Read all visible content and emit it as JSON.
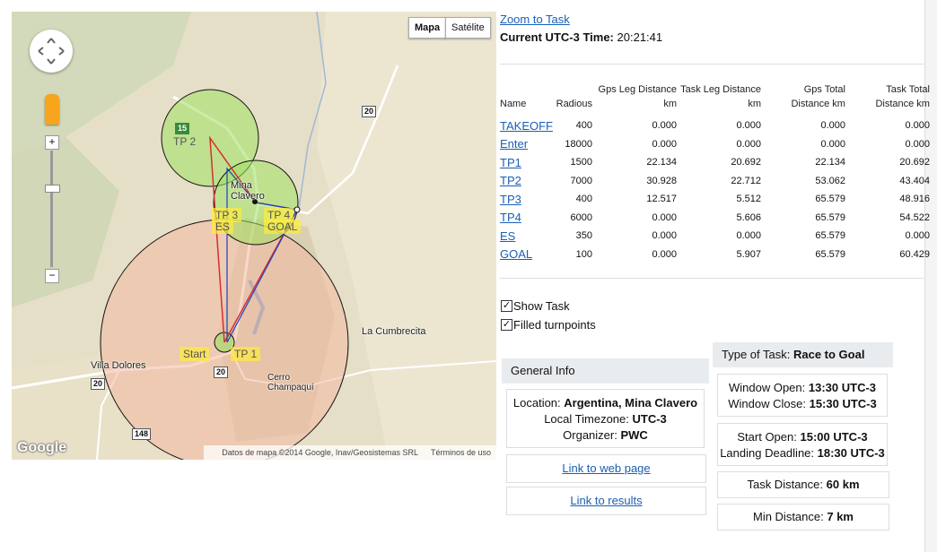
{
  "map": {
    "type_buttons": {
      "map": "Mapa",
      "satellite": "Satélite"
    },
    "attribution": "Datos de mapa ©2014 Google, Inav/Geosistemas SRL",
    "terms": "Términos de uso",
    "logo": "Google",
    "places": {
      "mina_clavero": "Mina\nClavero",
      "la_cumbrecita": "La Cumbrecita",
      "villa_dolores": "Villa Dolores",
      "cerro": "Cerro\nChampaquí"
    },
    "route_shields": [
      "15",
      "20",
      "20",
      "20",
      "148"
    ],
    "turnpoint_labels": {
      "tp2": "TP 2",
      "tp3": "TP 3",
      "es": "ES",
      "tp4": "TP 4",
      "goal": "GOAL",
      "start": "Start",
      "tp1": "TP 1"
    },
    "zoom_in": "+",
    "zoom_out": "−"
  },
  "header": {
    "zoom_link": "Zoom to Task",
    "time_label": "Current UTC-3 Time:",
    "time_value": "20:21:41"
  },
  "table": {
    "headers": [
      "Name",
      "Radious",
      "Gps Leg Distance km",
      "Task Leg Distance km",
      "Gps Total Distance km",
      "Task Total Distance km"
    ],
    "rows": [
      {
        "name": "TAKEOFF",
        "radius": "400",
        "gps_leg": "0.000",
        "task_leg": "0.000",
        "gps_total": "0.000",
        "task_total": "0.000"
      },
      {
        "name": "Enter",
        "radius": "18000",
        "gps_leg": "0.000",
        "task_leg": "0.000",
        "gps_total": "0.000",
        "task_total": "0.000"
      },
      {
        "name": "TP1",
        "radius": "1500",
        "gps_leg": "22.134",
        "task_leg": "20.692",
        "gps_total": "22.134",
        "task_total": "20.692"
      },
      {
        "name": "TP2",
        "radius": "7000",
        "gps_leg": "30.928",
        "task_leg": "22.712",
        "gps_total": "53.062",
        "task_total": "43.404"
      },
      {
        "name": "TP3",
        "radius": "400",
        "gps_leg": "12.517",
        "task_leg": "5.512",
        "gps_total": "65.579",
        "task_total": "48.916"
      },
      {
        "name": "TP4",
        "radius": "6000",
        "gps_leg": "0.000",
        "task_leg": "5.606",
        "gps_total": "65.579",
        "task_total": "54.522"
      },
      {
        "name": "ES",
        "radius": "350",
        "gps_leg": "0.000",
        "task_leg": "0.000",
        "gps_total": "65.579",
        "task_total": "0.000"
      },
      {
        "name": "GOAL",
        "radius": "100",
        "gps_leg": "0.000",
        "task_leg": "5.907",
        "gps_total": "65.579",
        "task_total": "60.429"
      }
    ]
  },
  "options": {
    "show_task": {
      "label": "Show Task",
      "checked": true
    },
    "filled_turnpoints": {
      "label": "Filled turnpoints",
      "checked": true
    }
  },
  "general_info": {
    "title": "General Info",
    "location_label": "Location:",
    "location_value": "Argentina, Mina Clavero",
    "timezone_label": "Local Timezone:",
    "timezone_value": "UTC-3",
    "organizer_label": "Organizer:",
    "organizer_value": "PWC",
    "web_link": "Link to web page",
    "results_link": "Link to results"
  },
  "task_info": {
    "type_label": "Type of Task:",
    "type_value": "Race to Goal",
    "window_open_label": "Window Open:",
    "window_open_value": "13:30 UTC-3",
    "window_close_label": "Window Close:",
    "window_close_value": "15:30 UTC-3",
    "start_open_label": "Start Open:",
    "start_open_value": "15:00 UTC-3",
    "deadline_label": "Landing Deadline:",
    "deadline_value": "18:30 UTC-3",
    "distance_label": "Task Distance:",
    "distance_value": "60 km",
    "min_label": "Min Distance:",
    "min_value": "7 km"
  },
  "colors": {
    "link": "#1a5fb4",
    "large_circle_fill": "#f2b8a0",
    "tp_circle_fill": "#9ee060",
    "task_line_red": "#d43030",
    "task_line_blue": "#2040c0"
  }
}
